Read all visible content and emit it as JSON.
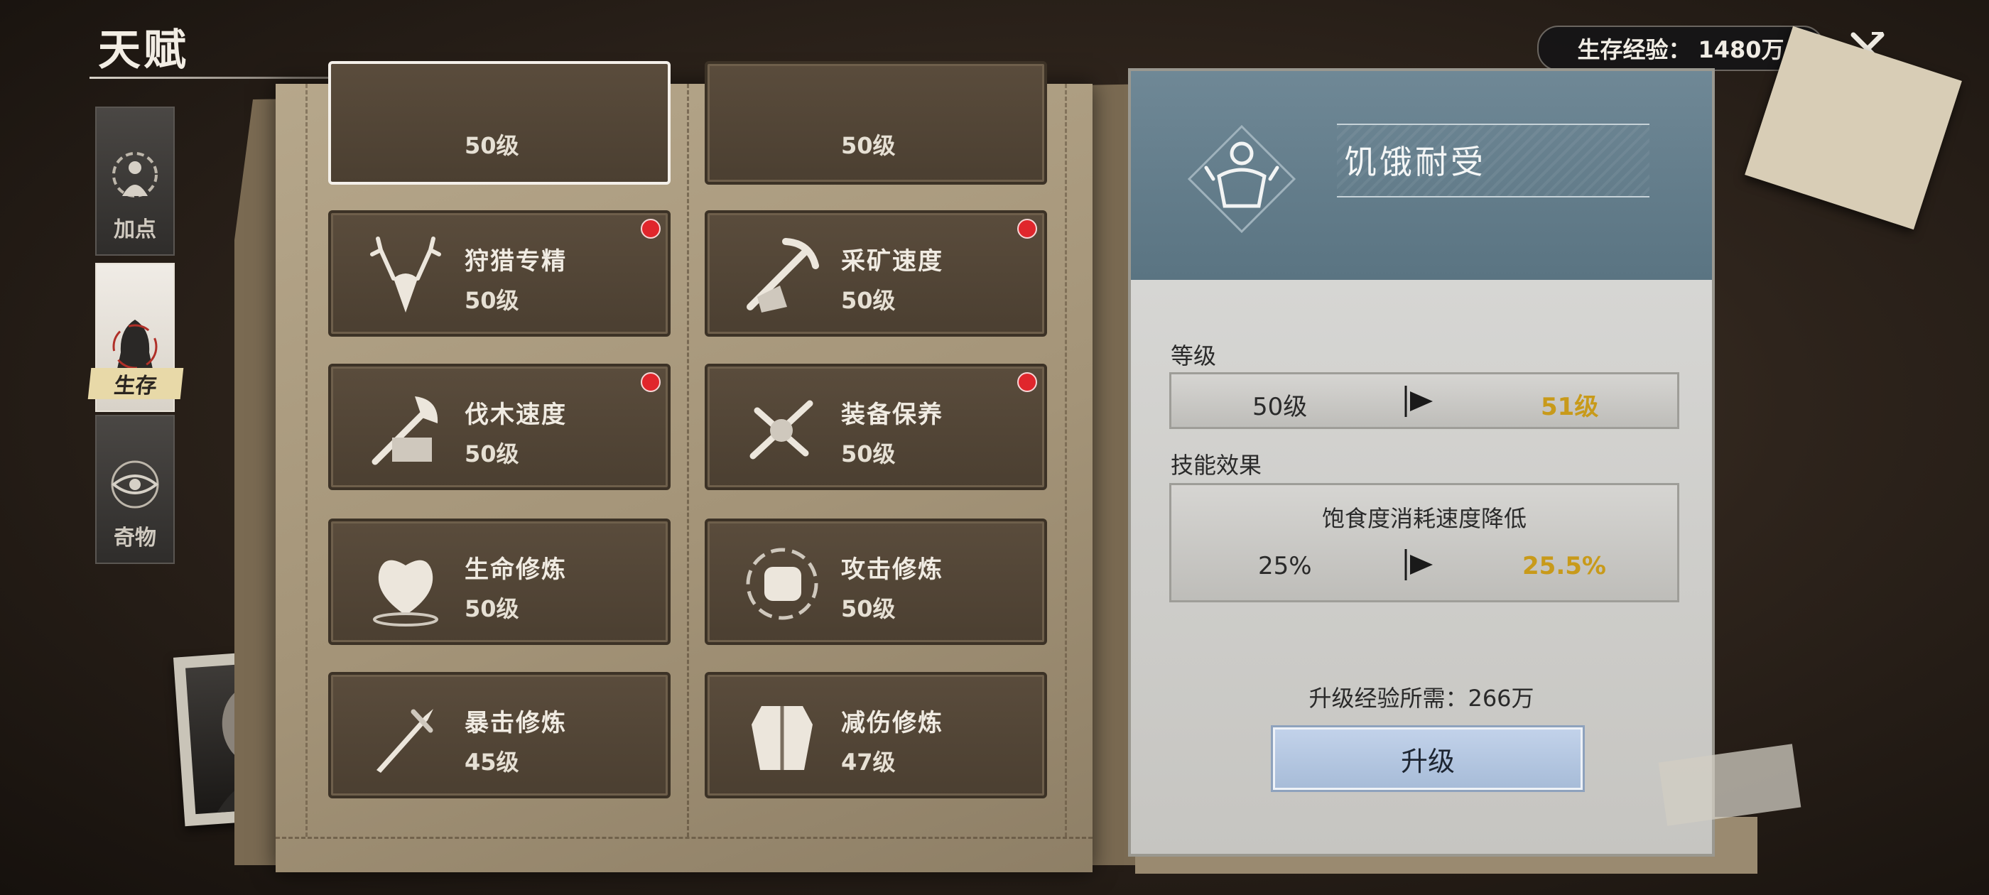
{
  "header": {
    "title": "天赋",
    "exp_label": "生存经验：",
    "exp_value": "1480万"
  },
  "side_tabs": [
    {
      "label": "加点",
      "icon": "figure-sun-icon",
      "active": false
    },
    {
      "label": "生存",
      "icon": "hooded-figure-icon",
      "active": true
    },
    {
      "label": "奇物",
      "icon": "eye-sigil-icon",
      "active": false
    }
  ],
  "cards": [
    {
      "name": "",
      "level": "50级",
      "icon": "partial-icon",
      "badge": false,
      "selected": true
    },
    {
      "name": "",
      "level": "50级",
      "icon": "partial-icon",
      "badge": false,
      "selected": false
    },
    {
      "name": "狩猎专精",
      "level": "50级",
      "icon": "deer-head-icon",
      "badge": true
    },
    {
      "name": "采矿速度",
      "level": "50级",
      "icon": "pickaxe-icon",
      "badge": true
    },
    {
      "name": "伐木速度",
      "level": "50级",
      "icon": "axe-icon",
      "badge": true
    },
    {
      "name": "装备保养",
      "level": "50级",
      "icon": "tools-icon",
      "badge": true
    },
    {
      "name": "生命修炼",
      "level": "50级",
      "icon": "heart-icon",
      "badge": false
    },
    {
      "name": "攻击修炼",
      "level": "50级",
      "icon": "fist-icon",
      "badge": false
    },
    {
      "name": "暴击修炼",
      "level": "45级",
      "icon": "dagger-icon",
      "badge": false
    },
    {
      "name": "减伤修炼",
      "level": "47级",
      "icon": "armor-icon",
      "badge": false
    }
  ],
  "detail": {
    "name": "饥饿耐受",
    "icon": "hunger-figure-icon",
    "level_label": "等级",
    "level_current": "50级",
    "level_next": "51级",
    "effect_label": "技能效果",
    "effect_title": "饱食度消耗速度降低",
    "effect_current": "25%",
    "effect_next": "25.5%",
    "cost_label": "升级经验所需：",
    "cost_value": "266万",
    "upgrade_label": "升级"
  },
  "colors": {
    "highlight_gold": "#c89a1a",
    "badge_red": "#e0262c",
    "panel_header": "#6f8896",
    "upgrade_button": "#b4c6e0"
  }
}
